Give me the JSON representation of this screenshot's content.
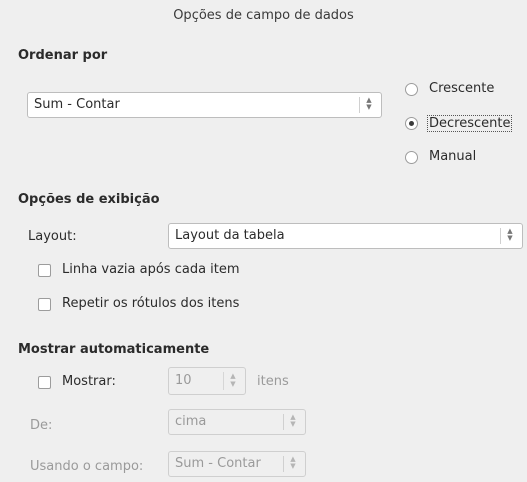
{
  "dialog": {
    "title": "Opções de campo de dados"
  },
  "sort": {
    "heading": "Ordenar por",
    "field_value": "Sum - Contar",
    "options": [
      {
        "label": "Crescente",
        "checked": false
      },
      {
        "label": "Decrescente",
        "checked": true
      },
      {
        "label": "Manual",
        "checked": false
      }
    ]
  },
  "display": {
    "heading": "Opções de exibição",
    "layout_label": "Layout:",
    "layout_value": "Layout da tabela",
    "empty_line_label": "Linha vazia após cada item",
    "repeat_labels_label": "Repetir os rótulos dos itens"
  },
  "auto": {
    "heading": "Mostrar automaticamente",
    "show_label": "Mostrar:",
    "show_value": "10",
    "items_label": "itens",
    "from_label": "De:",
    "from_value": "cima",
    "using_label": "Usando o campo:",
    "using_value": "Sum - Contar"
  }
}
